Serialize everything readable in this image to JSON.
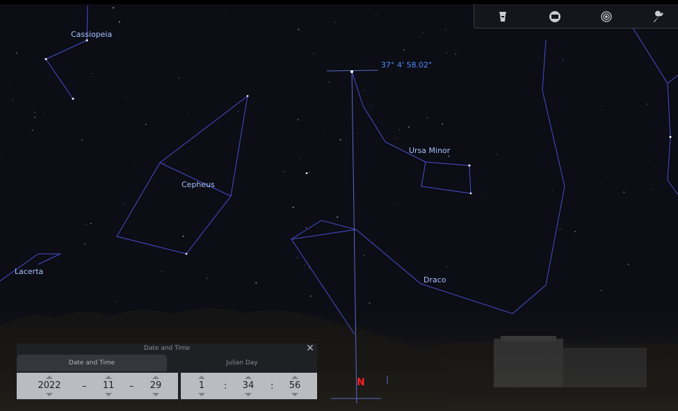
{
  "sky": {
    "constellations": [
      "Cassiopeia",
      "Cepheus",
      "Lacerta",
      "Ursa Minor",
      "Draco"
    ],
    "altitude_readout": "37° 4' 58.02\"",
    "compass": "N",
    "compass_color": "#ff2020",
    "line_color": "#4b4fd0",
    "label_color": "#a6c2ff"
  },
  "toolbar": {
    "icons": [
      "flashlight-icon",
      "window-icon",
      "target-icon",
      "wrench-icon"
    ]
  },
  "dialog": {
    "title": "Date and Time",
    "tabs": [
      "Date and Time",
      "Julian Day"
    ],
    "active_tab": "Date and Time",
    "date": {
      "year": "2022",
      "month": "11",
      "day": "29",
      "separator": "–"
    },
    "time": {
      "hour": "1",
      "minute": "34",
      "second": "56",
      "separator": ":"
    }
  }
}
